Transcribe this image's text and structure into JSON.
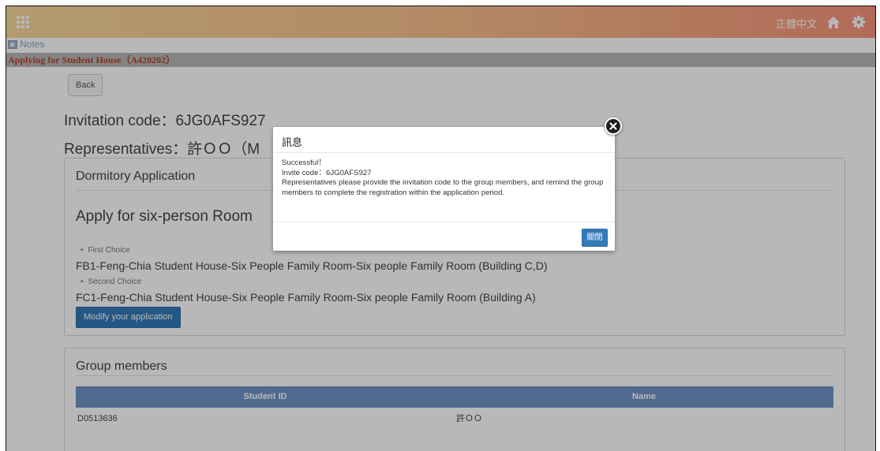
{
  "topbar": {
    "lang_label": "正體中文",
    "colors": {
      "start": "#f8d79b",
      "end": "#f7947a"
    },
    "icons": [
      "apps-grid-icon",
      "home-icon",
      "gear-icon"
    ]
  },
  "notes": {
    "label": "Notes",
    "icon": "notes-icon"
  },
  "page_title": "Applying for Student House（A420202）",
  "back_button": "Back",
  "invitation": {
    "label": "Invitation code：6JG0AFS927"
  },
  "representative": {
    "label": "Representatives：許ＯＯ（M"
  },
  "application": {
    "heading": "Dormitory Application",
    "room_title": "Apply for six-person Room",
    "first_choice_label": "First Choice",
    "first_choice_value": "FB1-Feng-Chia Student House-Six People Family Room-Six people Family Room (Building C,D)",
    "second_choice_label": "Second Choice",
    "second_choice_value": "FC1-Feng-Chia Student House-Six People Family Room-Six people Family Room (Building A)",
    "modify_button": "Modify your application"
  },
  "group": {
    "heading": "Group members",
    "columns": [
      "Student ID",
      "Name"
    ],
    "rows": [
      {
        "student_id": "D0513636",
        "name": "許ＯＯ"
      }
    ]
  },
  "modal": {
    "title": "訊息",
    "line1": "Successful！",
    "line2": "Invite code：6JG0AFS927",
    "line3": "Representatives please provide the invitation code to the group members, and remind the group members to complete the registration within the application period.",
    "close_button": "關閉",
    "close_icon": "close-icon"
  }
}
